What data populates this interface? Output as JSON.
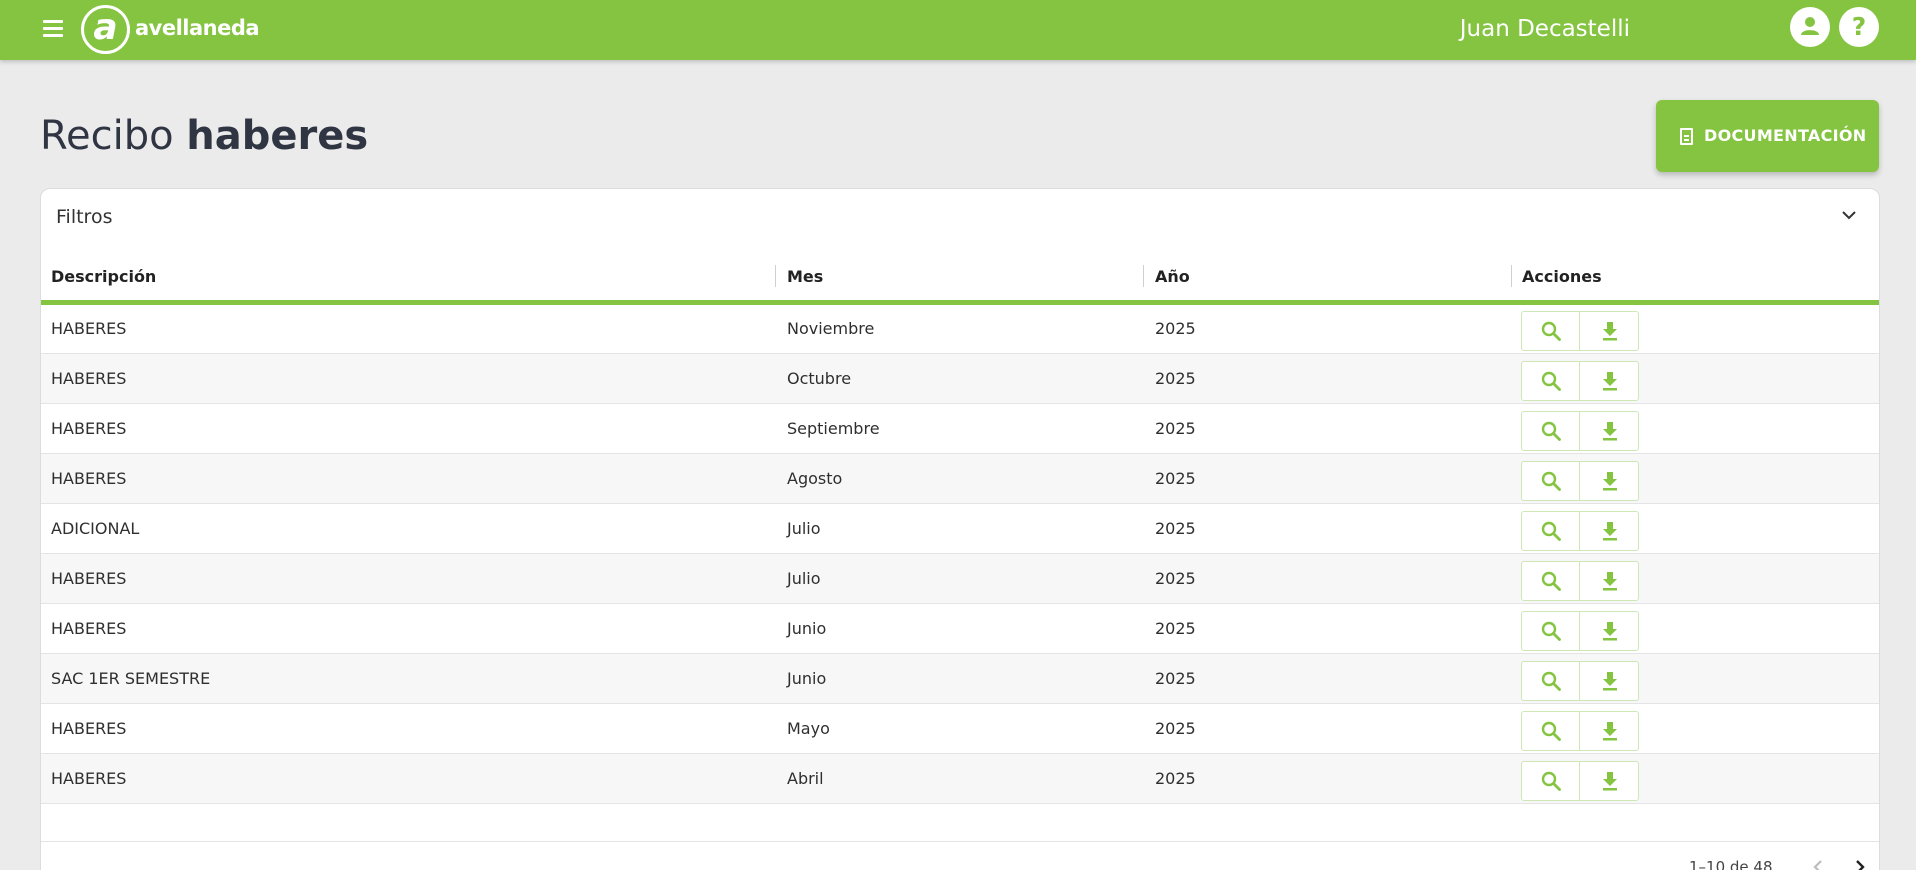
{
  "header": {
    "logo_letter": "a",
    "logo_text": "avellaneda",
    "user_name": "Juan Decastelli",
    "help_symbol": "?",
    "accent_color": "#84c441"
  },
  "page": {
    "title_light": "Recibo ",
    "title_bold": "haberes",
    "doc_button_label": "DOCUMENTACIÓN"
  },
  "filters": {
    "label": "Filtros"
  },
  "table": {
    "columns": [
      "Descripción",
      "Mes",
      "Año",
      "Acciones"
    ],
    "rows": [
      {
        "descripcion": "HABERES",
        "mes": "Noviembre",
        "anio": "2025"
      },
      {
        "descripcion": "HABERES",
        "mes": "Octubre",
        "anio": "2025"
      },
      {
        "descripcion": "HABERES",
        "mes": "Septiembre",
        "anio": "2025"
      },
      {
        "descripcion": "HABERES",
        "mes": "Agosto",
        "anio": "2025"
      },
      {
        "descripcion": "ADICIONAL",
        "mes": "Julio",
        "anio": "2025"
      },
      {
        "descripcion": "HABERES",
        "mes": "Julio",
        "anio": "2025"
      },
      {
        "descripcion": "HABERES",
        "mes": "Junio",
        "anio": "2025"
      },
      {
        "descripcion": "SAC 1ER SEMESTRE",
        "mes": "Junio",
        "anio": "2025"
      },
      {
        "descripcion": "HABERES",
        "mes": "Mayo",
        "anio": "2025"
      },
      {
        "descripcion": "HABERES",
        "mes": "Abril",
        "anio": "2025"
      }
    ]
  },
  "pagination": {
    "range_text": "1–10 de 48"
  },
  "icons": {
    "menu": "menu-icon",
    "user": "user-icon",
    "help": "help-icon",
    "document": "document-icon",
    "chevron": "chevron-down-icon",
    "view": "search-icon",
    "download": "download-icon"
  }
}
